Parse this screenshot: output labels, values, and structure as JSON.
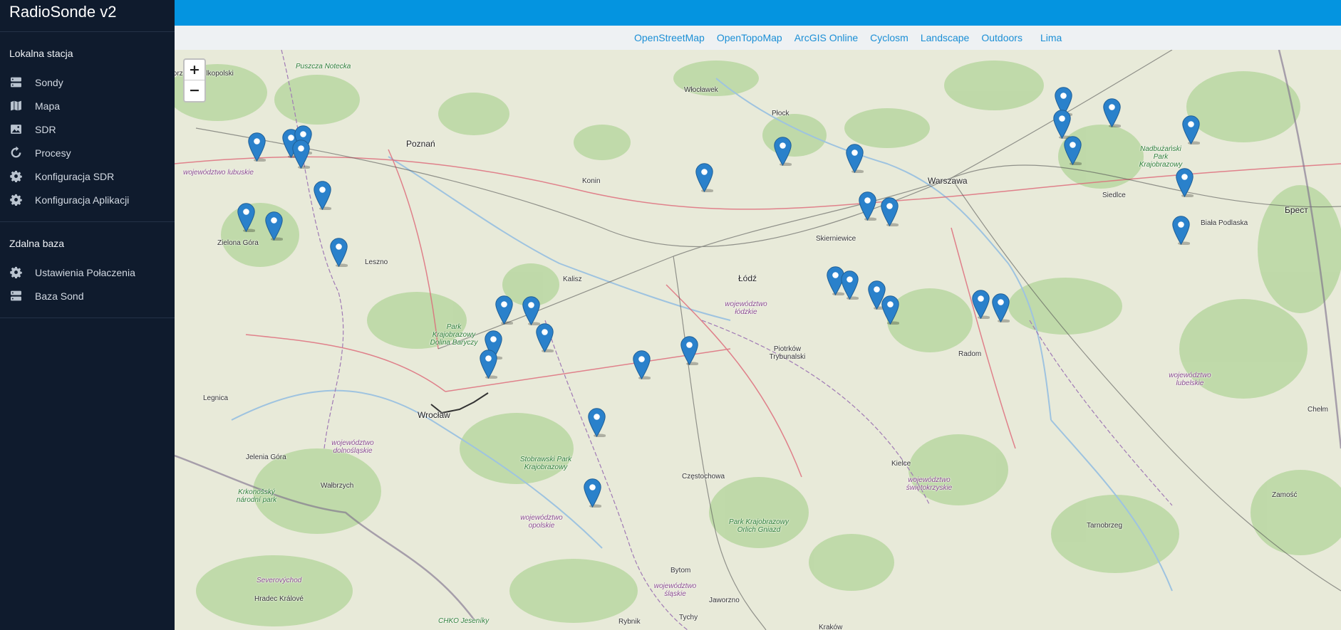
{
  "app": {
    "title": "RadioSonde v2"
  },
  "sidebar": {
    "local": {
      "title": "Lokalna stacja",
      "items": [
        {
          "label": "Sondy",
          "icon": "server-icon"
        },
        {
          "label": "Mapa",
          "icon": "map-icon"
        },
        {
          "label": "SDR",
          "icon": "image-icon"
        },
        {
          "label": "Procesy",
          "icon": "refresh-icon"
        },
        {
          "label": "Konfiguracja SDR",
          "icon": "gear-icon"
        },
        {
          "label": "Konfiguracja Aplikacji",
          "icon": "gear-icon"
        }
      ]
    },
    "remote": {
      "title": "Zdalna baza",
      "items": [
        {
          "label": "Ustawienia Połaczenia",
          "icon": "gear-icon"
        },
        {
          "label": "Baza Sond",
          "icon": "server-icon"
        }
      ]
    }
  },
  "layers": [
    "OpenStreetMap",
    "OpenTopoMap",
    "ArcGIS Online",
    "Cyclosm",
    "Landscape",
    "Outdoors",
    "Lima"
  ],
  "map": {
    "zoom_in": "+",
    "zoom_out": "−",
    "marker_color": "#2a81cb",
    "marker_count": 39,
    "places": [
      "Poznań",
      "Warszawa",
      "Łódź",
      "Wrocław",
      "Konin",
      "Kalisz",
      "Leszno",
      "Płock",
      "Włocławek",
      "Skierniewice",
      "Siedlce",
      "Biała Podlaska",
      "Брест",
      "Radom",
      "Kielce",
      "Częstochowa",
      "Piotrków Trybunalski",
      "Legnica",
      "Jelenia Góra",
      "Wałbrzych",
      "Zielona Góra",
      "Bytom",
      "Jaworzno",
      "Tychy",
      "Rybnik",
      "Chełm",
      "Zamość",
      "Tarnobrzeg",
      "Hradec Králové",
      "Kraków",
      "Gorzów Wielkopolski"
    ],
    "regions": [
      "województwo lubuskie",
      "województwo łódzkie",
      "województwo lubelskie",
      "województwo dolnośląskie",
      "województwo opolskie",
      "województwo śląskie",
      "województwo świętokrzyskie",
      "Severovýchod"
    ],
    "parks": [
      "Puszcza Notecka",
      "Park Krajobrazowy Dolina Baryczy",
      "Stobrawski Park Krajobrazowy",
      "Park Krajobrazowy Orlich Gniazd",
      "Nadbużański Park Krajobrazowy",
      "Krkonošský národní park",
      "CHKO Jeseníky"
    ]
  }
}
